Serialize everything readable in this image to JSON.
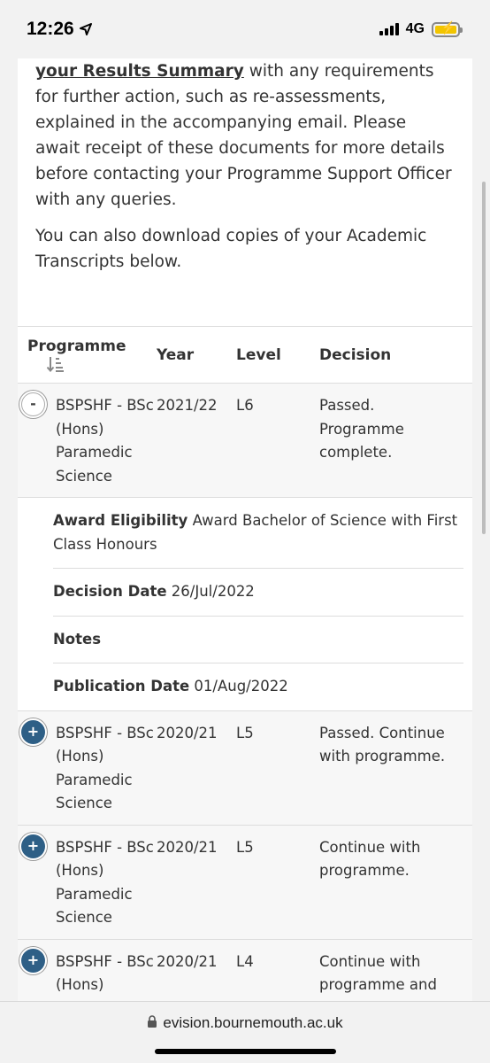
{
  "status_bar": {
    "time": "12:26",
    "network": "4G"
  },
  "intro": {
    "paragraph1_link": "your Results Summary",
    "paragraph1_rest": " with any requirements for further action, such as re-assessments, explained in the accompanying email. Please await receipt of these documents for more details before contacting your Programme Support Officer with any queries.",
    "paragraph2": "You can also download copies of your Academic Transcripts below."
  },
  "table": {
    "headers": {
      "programme": "Programme",
      "year": "Year",
      "level": "Level",
      "decision": "Decision"
    },
    "rows": [
      {
        "toggle": "-",
        "programme": "BSPSHF - BSc (Hons) Paramedic Science",
        "year": "2021/22",
        "level": "L6",
        "decision": "Passed. Programme complete."
      },
      {
        "toggle": "+",
        "programme": "BSPSHF - BSc (Hons) Paramedic Science",
        "year": "2020/21",
        "level": "L5",
        "decision": "Passed. Continue with programme."
      },
      {
        "toggle": "+",
        "programme": "BSPSHF - BSc (Hons) Paramedic Science",
        "year": "2020/21",
        "level": "L5",
        "decision": "Continue with programme."
      },
      {
        "toggle": "+",
        "programme": "BSPSHF - BSc (Hons) Paramedic Science",
        "year": "2020/21",
        "level": "L4",
        "decision": "Continue with programme and complete"
      }
    ],
    "details": {
      "award_label": "Award Eligibility",
      "award_value": "Award Bachelor of Science with First Class Honours",
      "decision_date_label": "Decision Date",
      "decision_date_value": "26/Jul/2022",
      "notes_label": "Notes",
      "publication_date_label": "Publication Date",
      "publication_date_value": "01/Aug/2022"
    }
  },
  "url_bar": {
    "domain": "evision.bournemouth.ac.uk"
  },
  "icons": {
    "location": "location-arrow-icon",
    "signal": "signal-icon",
    "battery": "battery-charging-icon",
    "lock": "lock-icon",
    "sort": "sort-icon"
  }
}
